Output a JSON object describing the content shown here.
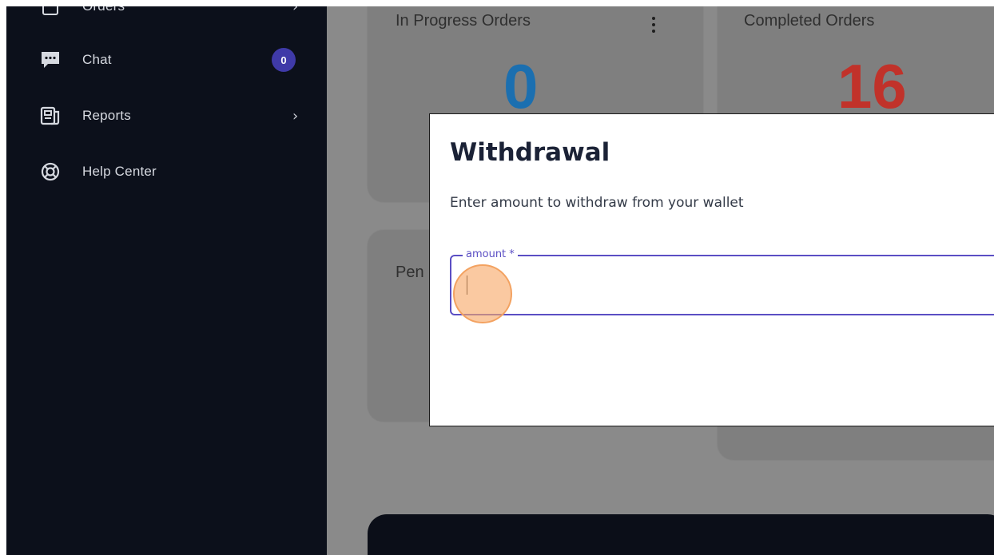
{
  "sidebar": {
    "items": [
      {
        "label": "Orders",
        "icon": "orders-icon",
        "has_chevron": true
      },
      {
        "label": "Chat",
        "icon": "chat-icon",
        "badge": "0"
      },
      {
        "label": "Reports",
        "icon": "reports-icon",
        "has_chevron": true
      },
      {
        "label": "Help Center",
        "icon": "lifebuoy-icon"
      }
    ]
  },
  "cards": {
    "in_progress": {
      "title": "In Progress Orders",
      "value": "0",
      "color": "#1b6fb0"
    },
    "completed": {
      "title": "Completed Orders",
      "value": "16",
      "color": "#c1322a"
    },
    "pending": {
      "title": "Pen"
    }
  },
  "modal": {
    "title": "Withdrawal",
    "subtitle": "Enter amount to withdraw from your wallet",
    "amount_label": "amount *",
    "amount_value": ""
  },
  "colors": {
    "sidebar_bg": "#0c101b",
    "badge_bg": "#3f3aa8",
    "field_accent": "#5b4fc4",
    "click_marker": "#f3a261"
  }
}
